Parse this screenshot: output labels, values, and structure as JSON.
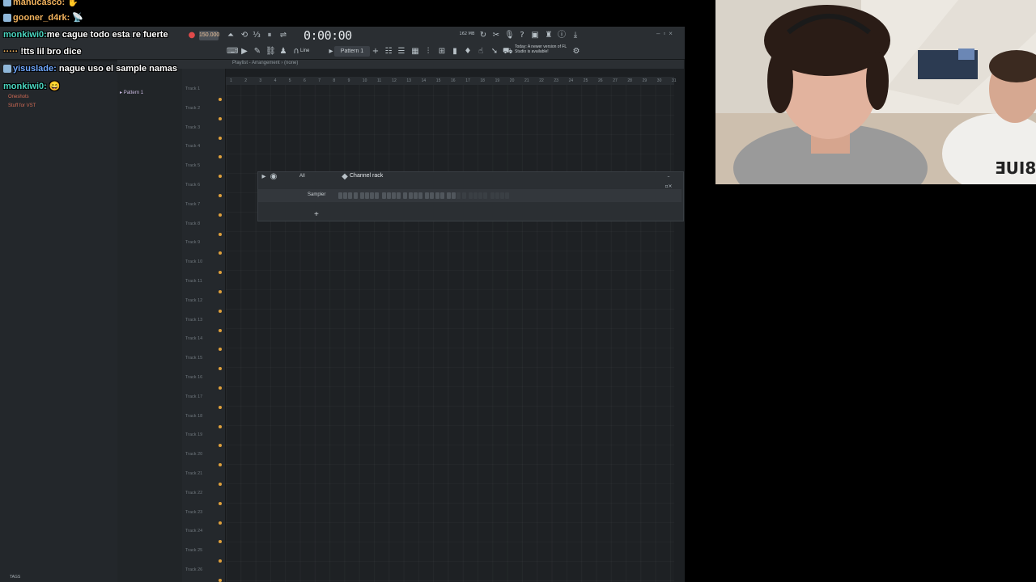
{
  "chat": [
    {
      "user": "manucasco:",
      "text": ""
    },
    {
      "user": "gooner_d4rk:",
      "text": ""
    },
    {
      "user": "monkiwi0:",
      "text": "me cague todo esta re fuerte"
    },
    {
      "user": "",
      "text": "!tts lil bro dice"
    },
    {
      "user": "yisuslade:",
      "text": "nague uso el sample namas"
    },
    {
      "user": "monkiwi0:",
      "text": ""
    }
  ],
  "toolbar": {
    "time": "0:00:00",
    "bpm": "150.000",
    "pattern": "Pattern 1",
    "mode": "Line",
    "news": "Today: A newer version of FL Studio is available!",
    "cpu": "162 MB"
  },
  "browser": {
    "items": [
      "Oneshots",
      "Stuff for VST"
    ],
    "tags": "TAGS"
  },
  "playlist": {
    "title": "Playlist - Arrangement › (none)",
    "pattern": "Pattern 1",
    "tracks": [
      "Track 1",
      "Track 2",
      "Track 3",
      "Track 4",
      "Track 5",
      "Track 6",
      "Track 7",
      "Track 8",
      "Track 9",
      "Track 10",
      "Track 11",
      "Track 12",
      "Track 13",
      "Track 14",
      "Track 15",
      "Track 16",
      "Track 17",
      "Track 18",
      "Track 19",
      "Track 20",
      "Track 21",
      "Track 22",
      "Track 23",
      "Track 24",
      "Track 25",
      "Track 26"
    ],
    "ruler": [
      "1",
      "2",
      "3",
      "4",
      "5",
      "6",
      "7",
      "8",
      "9",
      "10",
      "11",
      "12",
      "13",
      "14",
      "15",
      "16",
      "17",
      "18",
      "19",
      "20",
      "21",
      "22",
      "23",
      "24",
      "25",
      "26",
      "27",
      "28",
      "29",
      "30",
      "31"
    ]
  },
  "channel_rack": {
    "title": "Channel rack",
    "filter": "All",
    "channel": "Sampler"
  },
  "webcam": {
    "shirt_text": "ƎUI8"
  }
}
